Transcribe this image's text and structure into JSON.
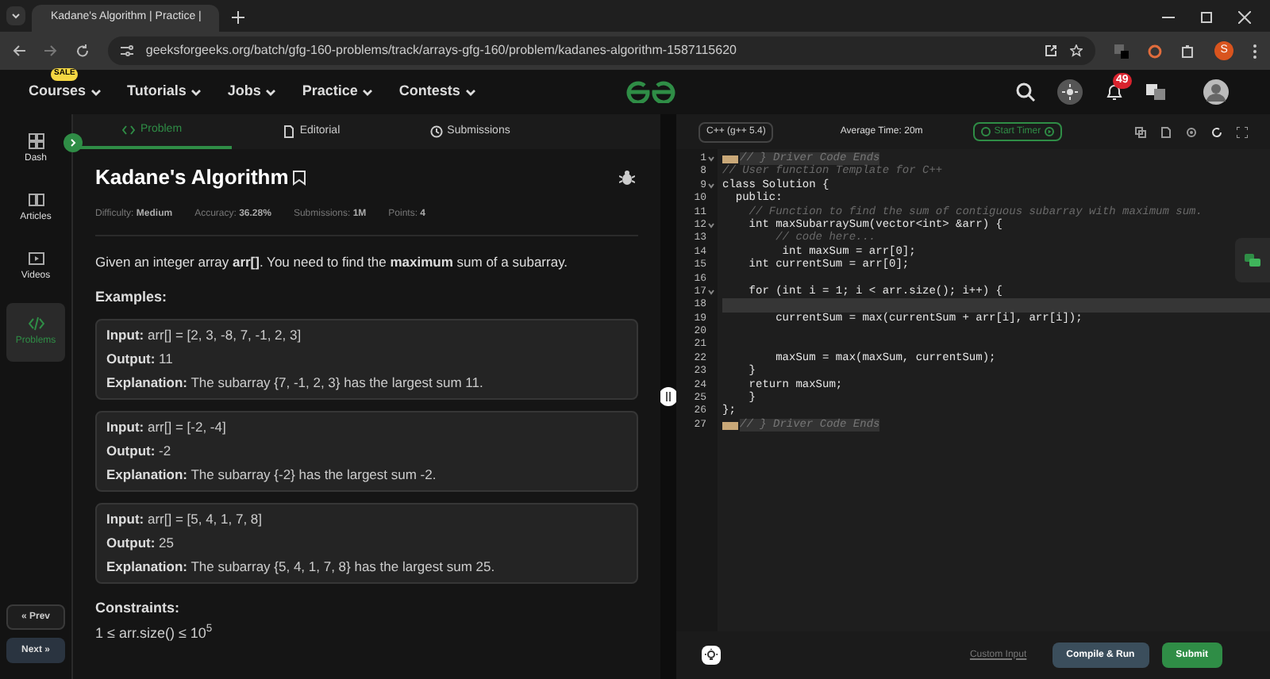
{
  "browser": {
    "tab_title": "Kadane's Algorithm | Practice |",
    "url": "geeksforgeeks.org/batch/gfg-160-problems/track/arrays-gfg-160/problem/kadanes-algorithm-1587115620",
    "profile_initial": "S"
  },
  "site_nav": {
    "items": [
      {
        "label": "Courses",
        "badge": "SALE"
      },
      {
        "label": "Tutorials"
      },
      {
        "label": "Jobs"
      },
      {
        "label": "Practice"
      },
      {
        "label": "Contests"
      }
    ],
    "notification_count": "49"
  },
  "sidebar": {
    "items": [
      {
        "label": "Dash",
        "selected": false
      },
      {
        "label": "Articles",
        "selected": false
      },
      {
        "label": "Videos",
        "selected": false
      },
      {
        "label": "Problems",
        "selected": true
      }
    ],
    "prev": "« Prev",
    "next": "Next »"
  },
  "problem": {
    "tabs": [
      {
        "label": "Problem",
        "selected": true
      },
      {
        "label": "Editorial",
        "selected": false
      },
      {
        "label": "Submissions",
        "selected": false
      }
    ],
    "title": "Kadane's Algorithm",
    "meta": [
      {
        "label": "Difficulty:",
        "value": "Medium"
      },
      {
        "label": "Accuracy:",
        "value": "36.28%"
      },
      {
        "label": "Submissions:",
        "value": "1M"
      },
      {
        "label": "Points:",
        "value": "4"
      }
    ],
    "description": "Given an integer array **arr[]**. You need to find the **maximum** sum of a subarray.",
    "examples_heading": "Examples:",
    "examples": [
      [
        {
          "label": "Input:",
          "value": "arr[] = [2, 3, -8, 7, -1, 2, 3]"
        },
        {
          "label": "Output:",
          "value": "11"
        },
        {
          "label": "Explanation:",
          "value": "The subarray {7, -1, 2, 3} has the largest sum 11."
        }
      ],
      [
        {
          "label": "Input:",
          "value": "arr[] = [-2, -4]"
        },
        {
          "label": "Output:",
          "value": "-2"
        },
        {
          "label": "Explanation:",
          "value": "The subarray {-2} has the largest sum -2."
        }
      ],
      [
        {
          "label": "Input:",
          "value": "arr[] = [5, 4, 1, 7, 8]"
        },
        {
          "label": "Output:",
          "value": "25"
        },
        {
          "label": "Explanation:",
          "value": "The subarray {5, 4, 1, 7, 8} has the largest sum 25."
        }
      ]
    ],
    "constraints_heading": "Constraints:",
    "constraints": [
      "1 ≤ arr.size() ≤ 10$^{5}$"
    ]
  },
  "editor": {
    "language": "C++ (g++ 5.4)",
    "average_time": "Average Time: 20m",
    "start_timer": "Start Timer",
    "lines": [
      {
        "number": "1",
        "kind": "folded",
        "text": "// } Driver Code Ends",
        "foldable": true,
        "current": false
      },
      {
        "number": "8",
        "kind": "comment",
        "text": "// User function Template for C++",
        "foldable": false,
        "current": false
      },
      {
        "number": "9",
        "kind": "code",
        "text": "class Solution {",
        "foldable": true,
        "current": false
      },
      {
        "number": "10",
        "kind": "code",
        "text": "  public:",
        "foldable": false,
        "current": false
      },
      {
        "number": "11",
        "kind": "comment",
        "text": "    // Function to find the sum of contiguous subarray with maximum sum.",
        "foldable": false,
        "current": false
      },
      {
        "number": "12",
        "kind": "code",
        "text": "    int maxSubarraySum(vector<int> &arr) {",
        "foldable": true,
        "current": false
      },
      {
        "number": "13",
        "kind": "comment",
        "text": "        // code here...",
        "foldable": false,
        "current": false
      },
      {
        "number": "14",
        "kind": "code",
        "text": "         int maxSum = arr[0];",
        "foldable": false,
        "current": false
      },
      {
        "number": "15",
        "kind": "code",
        "text": "    int currentSum = arr[0];",
        "foldable": false,
        "current": false
      },
      {
        "number": "16",
        "kind": "code",
        "foldable": false,
        "current": false
      },
      {
        "number": "17",
        "kind": "code",
        "text": "    for (int i = 1; i < arr.size(); i++) {",
        "foldable": true,
        "current": false
      },
      {
        "number": "18",
        "kind": "code",
        "foldable": false,
        "current": true
      },
      {
        "number": "19",
        "kind": "code",
        "text": "        currentSum = max(currentSum + arr[i], arr[i]);",
        "foldable": false,
        "current": false
      },
      {
        "number": "20",
        "kind": "code",
        "foldable": false,
        "current": false
      },
      {
        "number": "21",
        "kind": "code",
        "foldable": false,
        "current": false
      },
      {
        "number": "22",
        "kind": "code",
        "text": "        maxSum = max(maxSum, currentSum);",
        "foldable": false,
        "current": false
      },
      {
        "number": "23",
        "kind": "code",
        "text": "    }",
        "foldable": false,
        "current": false
      },
      {
        "number": "24",
        "kind": "code",
        "text": "    return maxSum;",
        "foldable": false,
        "current": false
      },
      {
        "number": "25",
        "kind": "code",
        "text": "    }",
        "foldable": false,
        "current": false
      },
      {
        "number": "26",
        "kind": "code",
        "text": "};",
        "foldable": false,
        "current": false
      },
      {
        "number": "27",
        "kind": "folded",
        "text": "// } Driver Code Ends",
        "foldable": false,
        "current": false
      }
    ],
    "custom_input": "Custom Input",
    "compile_run": "Compile & Run",
    "submit": "Submit"
  }
}
